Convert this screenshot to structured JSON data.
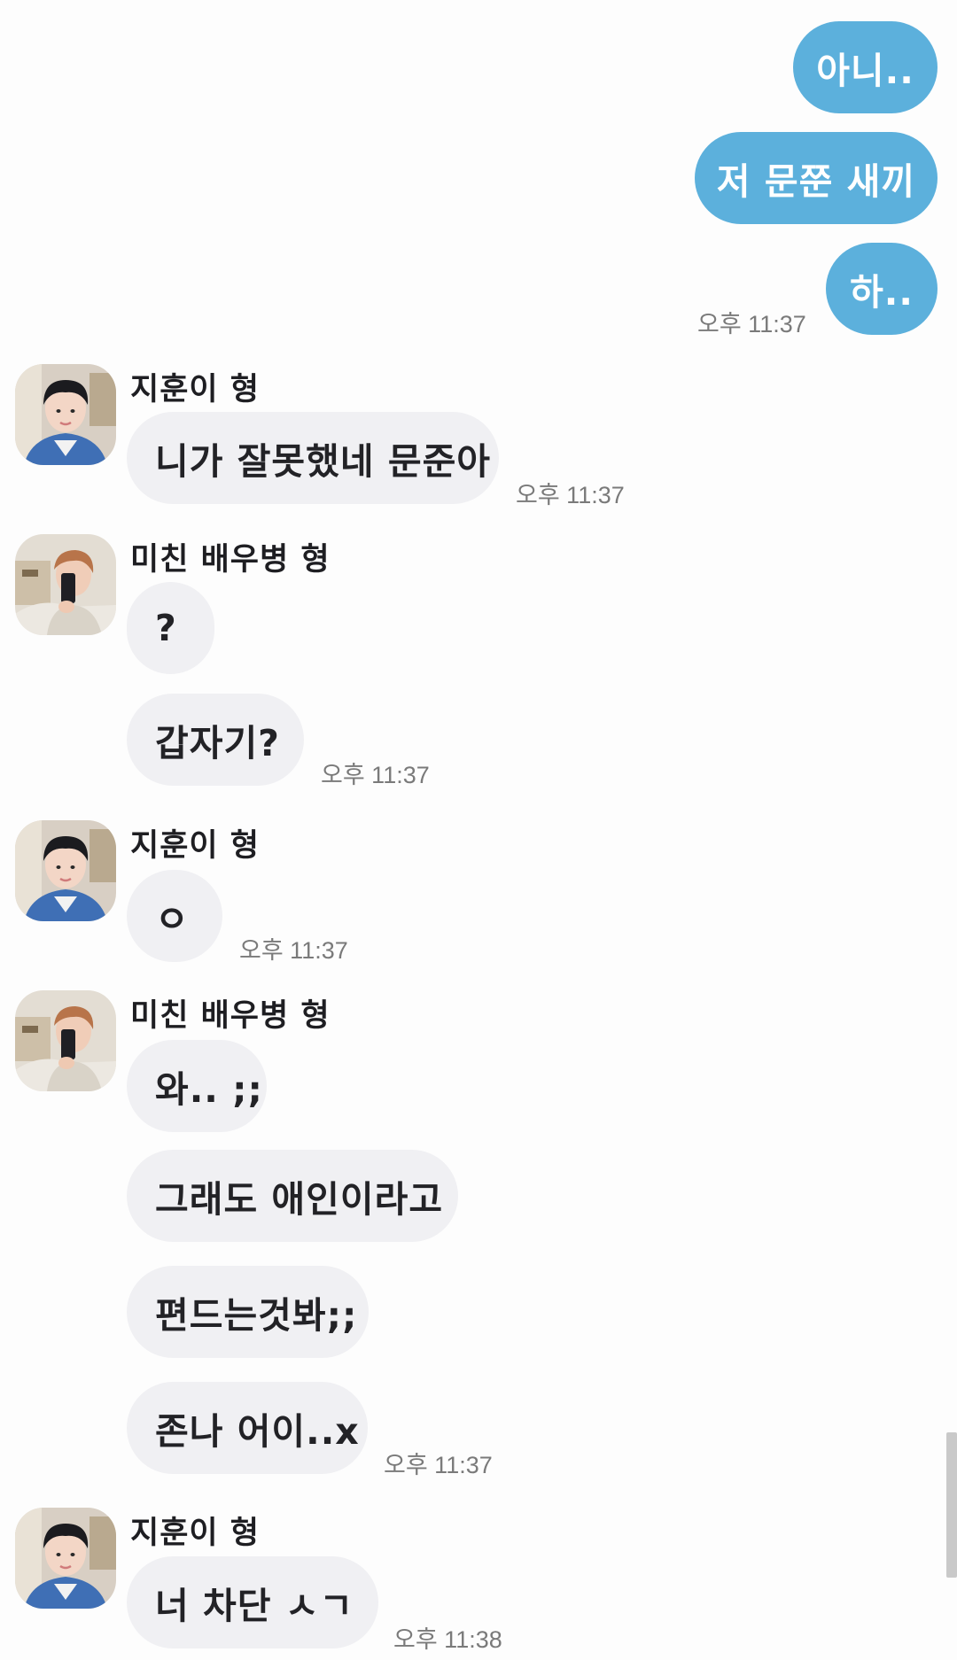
{
  "colors": {
    "outgoing_bubble": "#5cb0dc",
    "incoming_bubble": "#f0f0f3",
    "background": "#fdfdfd",
    "timestamp": "#7a7a7a"
  },
  "messages_out": [
    {
      "text": "아니.."
    },
    {
      "text": "저 문쭌 새끼"
    },
    {
      "text": "하.."
    }
  ],
  "time_out": "오후 11:37",
  "groups": [
    {
      "sender": "지훈이 형",
      "avatar": "jihoon-avatar",
      "messages": [
        "니가 잘못했네 문준아"
      ],
      "time": "오후 11:37"
    },
    {
      "sender": "미친 배우병 형",
      "avatar": "actor-avatar",
      "messages": [
        "?",
        "갑자기?"
      ],
      "time": "오후 11:37"
    },
    {
      "sender": "지훈이 형",
      "avatar": "jihoon-avatar",
      "messages": [
        "ㅇ"
      ],
      "time": "오후 11:37"
    },
    {
      "sender": "미친 배우병 형",
      "avatar": "actor-avatar",
      "messages": [
        "와.. ;;",
        "그래도 애인이라고",
        "편드는것봐;;",
        "존나 어이..x"
      ],
      "time": "오후 11:37"
    },
    {
      "sender": "지훈이 형",
      "avatar": "jihoon-avatar",
      "messages": [
        "너 차단 ㅅㄱ"
      ],
      "time": "오후 11:38"
    }
  ]
}
